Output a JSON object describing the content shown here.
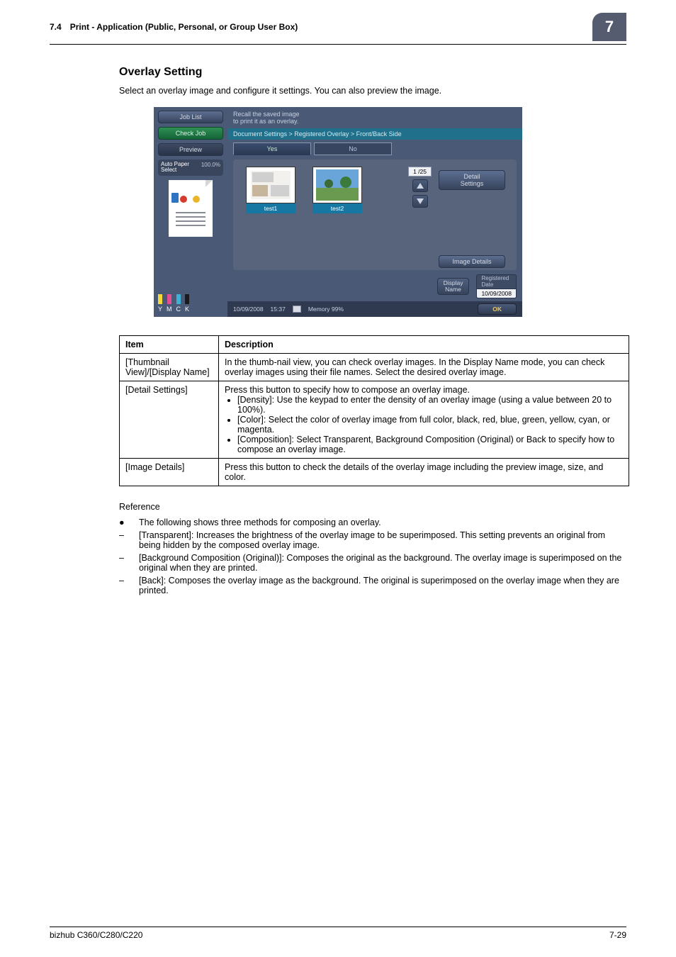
{
  "header": {
    "section_num": "7.4",
    "section_title": "Print - Application (Public, Personal, or Group User Box)",
    "chapter_badge": "7"
  },
  "heading": "Overlay Setting",
  "intro": "Select an overlay image and configure it settings. You can also preview the image.",
  "shot": {
    "left": {
      "job_list": "Job List",
      "check_job": "Check Job",
      "preview": "Preview",
      "paper_left": "Auto Paper\nSelect",
      "paper_right": "100.0%"
    },
    "toner": {
      "y": "Y",
      "m": "M",
      "c": "C",
      "k": "K"
    },
    "topmsg": "Recall the saved image\nto print it as an overlay.",
    "breadcrumb": "Document Settings > Registered Overlay > Front/Back Side",
    "tabs": {
      "yes": "Yes",
      "no": "No"
    },
    "thumbs": {
      "t1": "test1",
      "t2": "test2"
    },
    "pager": {
      "page": "1   /25"
    },
    "detail": "Detail\nSettings",
    "image_details": "Image Details",
    "display_name": "Display\nName",
    "reg_date_title": "Registered\nDate",
    "reg_date_val": "10/09/2008",
    "status": {
      "date": "10/09/2008",
      "time": "15:37",
      "mem_label": "Memory",
      "mem_val": "99%"
    },
    "ok": "OK"
  },
  "table": {
    "headers": {
      "item": "Item",
      "desc": "Description"
    },
    "rows": [
      {
        "item": "[Thumbnail View]/[Display Name]",
        "desc": "In the thumb-nail view, you can check overlay images. In the Display Name mode, you can check overlay images using their file names. Select the desired overlay image."
      },
      {
        "item": "[Detail Settings]",
        "desc_head": "Press this button to specify how to compose an overlay image.",
        "bullets": [
          "[Density]: Use the keypad to enter the density of an overlay image (using a value between 20 to 100%).",
          "[Color]: Select the color of overlay image from full color, black, red, blue, green, yellow, cyan, or magenta.",
          "[Composition]: Select Transparent, Background Composition (Original) or Back to specify how to compose an overlay image."
        ]
      },
      {
        "item": "[Image Details]",
        "desc": "Press this button to check the details of the overlay image including the preview image, size, and color."
      }
    ]
  },
  "reference": {
    "heading": "Reference",
    "lead_bullet": "The following shows three methods for composing an overlay.",
    "dashes": [
      "[Transparent]: Increases the brightness of the overlay image to be superimposed. This setting prevents an original from being hidden by the composed overlay image.",
      "[Background Composition (Original)]: Composes the original as the background. The overlay image is superimposed on the original when they are printed.",
      "[Back]: Composes the overlay image as the background. The original is superimposed on the overlay image when they are printed."
    ]
  },
  "footer": {
    "left": "bizhub C360/C280/C220",
    "right": "7-29"
  }
}
